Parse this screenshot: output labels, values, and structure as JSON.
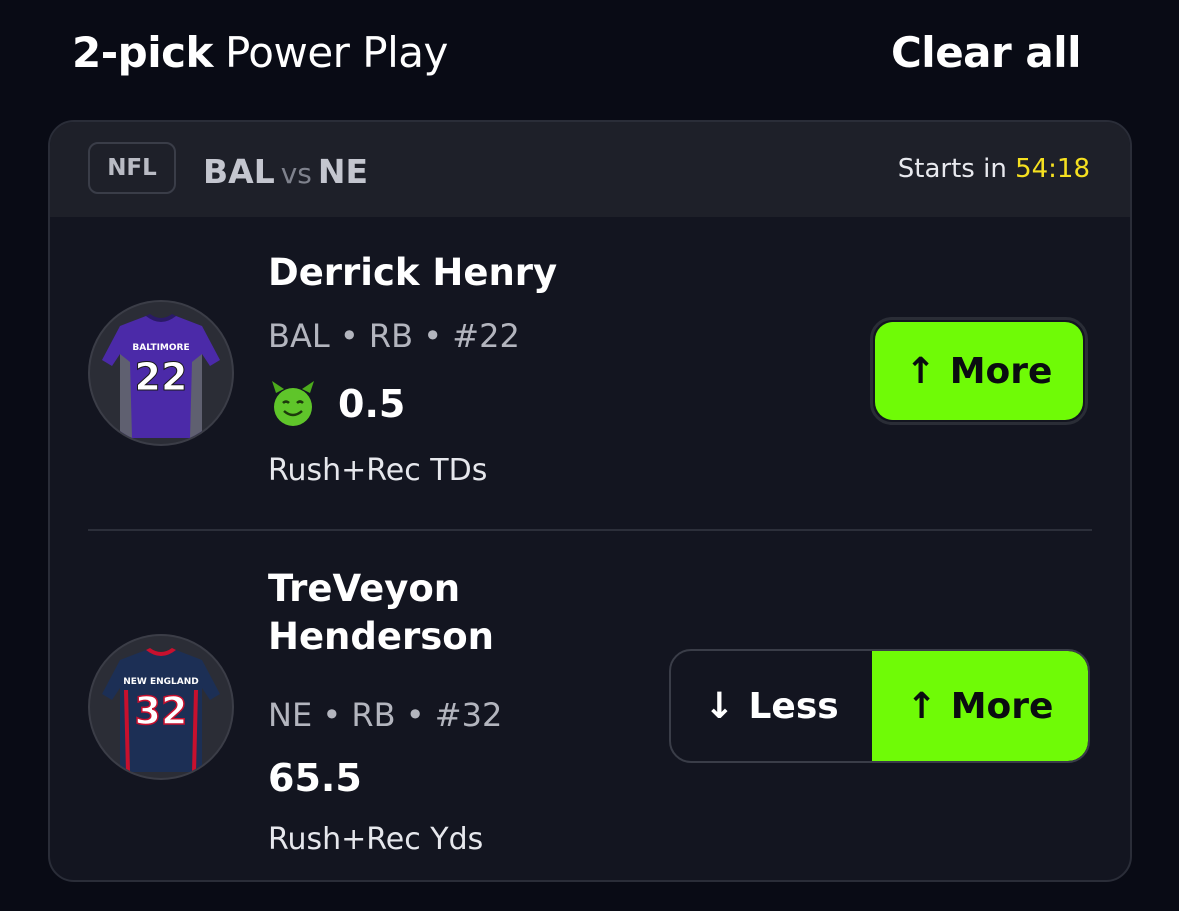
{
  "header": {
    "pick_count": "2-pick",
    "mode": "Power Play",
    "clear_label": "Clear all"
  },
  "game": {
    "league": "NFL",
    "home": "BAL",
    "vs": "vs",
    "away": "NE",
    "starts_label": "Starts in",
    "countdown": "54:18"
  },
  "picks": [
    {
      "name": "Derrick Henry",
      "meta": "BAL • RB • #22",
      "jersey_team": "BALTIMORE",
      "jersey_number": "22",
      "line": "0.5",
      "line_icon": "demon-icon",
      "stat": "Rush+Rec TDs",
      "more_label": "More"
    },
    {
      "name": "TreVeyon Henderson",
      "meta": "NE • RB • #32",
      "jersey_team": "NEW ENGLAND",
      "jersey_number": "32",
      "line": "65.5",
      "stat": "Rush+Rec Yds",
      "less_label": "Less",
      "more_label": "More"
    }
  ],
  "colors": {
    "accent_green": "#6ffb06",
    "timer_yellow": "#f5e020",
    "background": "#090b15",
    "card": "#131520"
  }
}
